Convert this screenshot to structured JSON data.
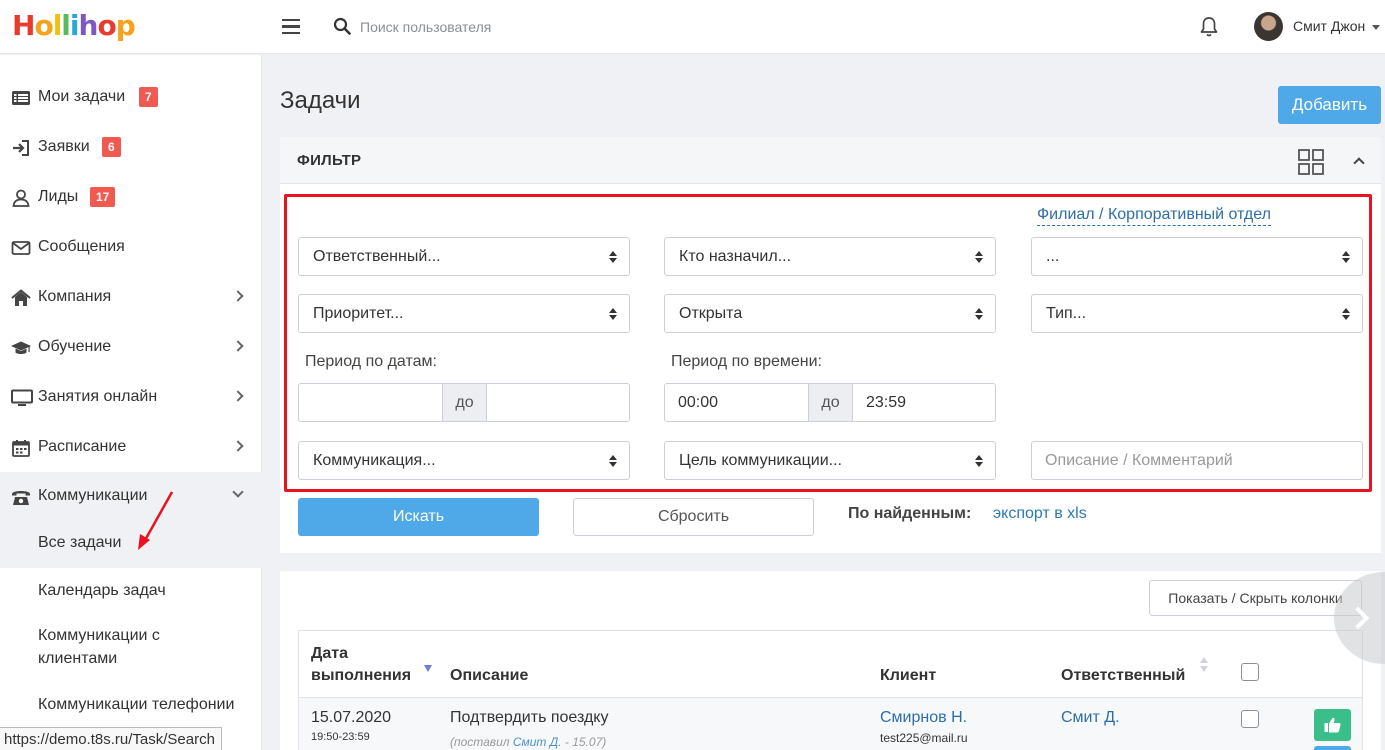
{
  "app": {
    "logo_letters": [
      "H",
      "o",
      "l",
      "l",
      "i",
      "h",
      "o",
      "p"
    ],
    "search_placeholder": "Поиск пользователя",
    "user_name": "Смит Джон"
  },
  "sidebar": {
    "items": [
      {
        "label": "Мои задачи",
        "badge": "7",
        "icon": "list-icon"
      },
      {
        "label": "Заявки",
        "badge": "6",
        "icon": "sign-in-icon"
      },
      {
        "label": "Лиды",
        "badge": "17",
        "icon": "user-icon"
      },
      {
        "label": "Сообщения",
        "icon": "envelope-icon"
      },
      {
        "label": "Компания",
        "icon": "home-icon"
      },
      {
        "label": "Обучение",
        "icon": "graduation-cap-icon"
      },
      {
        "label": "Занятия онлайн",
        "icon": "monitor-icon"
      },
      {
        "label": "Расписание",
        "icon": "calendar-icon"
      },
      {
        "label": "Коммуникации",
        "icon": "phone-icon"
      }
    ],
    "sub_items": [
      "Все задачи",
      "Календарь задач",
      "Коммуникации с клиентами",
      "Коммуникации телефонии"
    ],
    "status_url": "https://demo.t8s.ru/Task/Search"
  },
  "page": {
    "title": "Задачи",
    "add_button": "Добавить"
  },
  "filter": {
    "title": "ФИЛЬТР",
    "branch_link": "Филиал / Корпоративный отдел",
    "responsible": "Ответственный...",
    "assigned_by": "Кто назначил...",
    "branch_select": "...",
    "priority": "Приоритет...",
    "status": "Открыта",
    "type": "Тип...",
    "date_period_label": "Период по датам:",
    "time_period_label": "Период по времени:",
    "date_from": "",
    "date_to": "",
    "to_label": "до",
    "time_from": "00:00",
    "time_to": "23:59",
    "communication": "Коммуникация...",
    "communication_goal": "Цель коммуникации...",
    "description_placeholder": "Описание / Комментарий",
    "search_button": "Искать",
    "reset_button": "Сбросить",
    "found_label": "По найденным:",
    "export_link": "экспорт в xls"
  },
  "table": {
    "columns_button": "Показать / Скрыть колонки",
    "headers": {
      "date_line1": "Дата",
      "date_line2": "выполнения",
      "description": "Описание",
      "client": "Клиент",
      "responsible": "Ответственный"
    },
    "rows": [
      {
        "date": "15.07.2020",
        "time": "19:50-23:59",
        "description": "Подтвердить поездку",
        "meta_prefix": "(поставил ",
        "meta_author": "Смит Д.",
        "meta_suffix": " - 15.07)",
        "client": "Смирнов Н.",
        "client_email": "test225@mail.ru",
        "responsible": "Смит Д."
      }
    ]
  },
  "colors": {
    "accent": "#4fa9e8",
    "badge": "#f05a50",
    "highlight_frame": "#e8131f",
    "success": "#3bbf8a"
  }
}
